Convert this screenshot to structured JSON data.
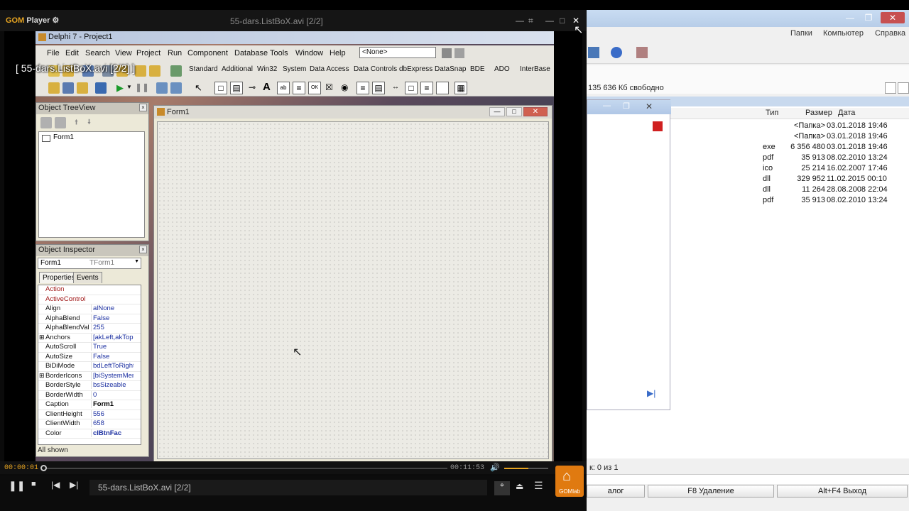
{
  "gom": {
    "brand_gom": "GOM",
    "brand_player": "Player",
    "file_title": "55-dars.ListBoX.avi  [2/2]",
    "overlay_title": "[ 55-dars.ListBoX.avi  [2/2] ]",
    "time_now": "00:00:01",
    "time_total": "00:11:53",
    "playlist_name": "55-dars.ListBoX.avi  [2/2]",
    "gomlab_label": "GOMlab",
    "progress_fraction": 0.0014,
    "volume_fraction": 0.55,
    "accent": "#e8a521"
  },
  "ide": {
    "title": "Delphi 7 - Project1",
    "menu": [
      "File",
      "Edit",
      "Search",
      "View",
      "Project",
      "Run",
      "Component",
      "Database",
      "Tools",
      "Window",
      "Help"
    ],
    "combo_none": "<None>",
    "palette_tabs": [
      "Standard",
      "Additional",
      "Win32",
      "System",
      "Data Access",
      "Data Controls",
      "dbExpress",
      "DataSnap",
      "BDE",
      "ADO",
      "InterBase"
    ],
    "otv_title": "Object TreeView",
    "otv_item": "Form1",
    "oi_title": "Object Inspector",
    "oi_object": "Form1",
    "oi_object_type": "TForm1",
    "oi_tab_properties": "Properties",
    "oi_tab_events": "Events",
    "oi_status": "All shown",
    "properties": [
      {
        "name": "Action",
        "value": ""
      },
      {
        "name": "ActiveControl",
        "value": ""
      },
      {
        "name": "Align",
        "value": "alNone"
      },
      {
        "name": "AlphaBlend",
        "value": "False"
      },
      {
        "name": "AlphaBlendVal",
        "value": "255"
      },
      {
        "name": "Anchors",
        "value": "[akLeft,akTop"
      },
      {
        "name": "AutoScroll",
        "value": "True"
      },
      {
        "name": "AutoSize",
        "value": "False"
      },
      {
        "name": "BiDiMode",
        "value": "bdLeftToRight"
      },
      {
        "name": "BorderIcons",
        "value": "[biSystemMen"
      },
      {
        "name": "BorderStyle",
        "value": "bsSizeable"
      },
      {
        "name": "BorderWidth",
        "value": "0"
      },
      {
        "name": "Caption",
        "value": "Form1"
      },
      {
        "name": "ClientHeight",
        "value": "556"
      },
      {
        "name": "ClientWidth",
        "value": "658"
      },
      {
        "name": "Color",
        "value": "clBtnFac"
      }
    ],
    "form_title": "Form1"
  },
  "tc": {
    "menu": [
      "Папки",
      "Компьютер",
      "Справка"
    ],
    "free_space": "135 636 Кб свободно",
    "col_type": "Тип",
    "col_size": "Размер",
    "col_date": "Дата",
    "rows": [
      {
        "type": "",
        "size": "<Папка>",
        "date": "03.01.2018 19:46"
      },
      {
        "type": "",
        "size": "<Папка>",
        "date": "03.01.2018 19:46"
      },
      {
        "type": "exe",
        "size": "6 356 480",
        "date": "03.01.2018 19:46"
      },
      {
        "type": "pdf",
        "size": "35 913",
        "date": "08.02.2010 13:24"
      },
      {
        "type": "ico",
        "size": "25 214",
        "date": "16.02.2007 17:46"
      },
      {
        "type": "dll",
        "size": "329 952",
        "date": "11.02.2015 00:10"
      },
      {
        "type": "dll",
        "size": "11 264",
        "date": "28.08.2008 22:04"
      },
      {
        "type": "pdf",
        "size": "35 913",
        "date": "08.02.2010 13:24"
      }
    ],
    "status": "к: 0 из 1",
    "fkey_left": "алог",
    "fkey_f8": "F8 Удаление",
    "fkey_altf4": "Alt+F4 Выход"
  }
}
